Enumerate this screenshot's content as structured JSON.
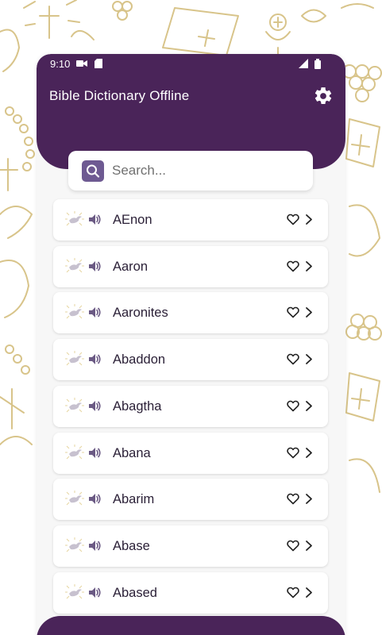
{
  "status_bar": {
    "time": "9:10"
  },
  "app": {
    "title": "Bible Dictionary Offline"
  },
  "search": {
    "placeholder": "Search..."
  },
  "entries": [
    {
      "label": "AEnon"
    },
    {
      "label": "Aaron"
    },
    {
      "label": "Aaronites"
    },
    {
      "label": "Abaddon"
    },
    {
      "label": "Abagtha"
    },
    {
      "label": "Abana"
    },
    {
      "label": "Abarim"
    },
    {
      "label": "Abase"
    },
    {
      "label": "Abased"
    }
  ],
  "colors": {
    "primary": "#4a2459",
    "search_accent": "#6e5a92",
    "background_art": "#d8c48a"
  },
  "icons": {
    "settings": "gear-icon",
    "search": "search-icon",
    "entry_leading": "dove-icon",
    "entry_audio": "speaker-icon",
    "entry_favorite": "heart-icon",
    "entry_open": "chevron-right-icon"
  }
}
